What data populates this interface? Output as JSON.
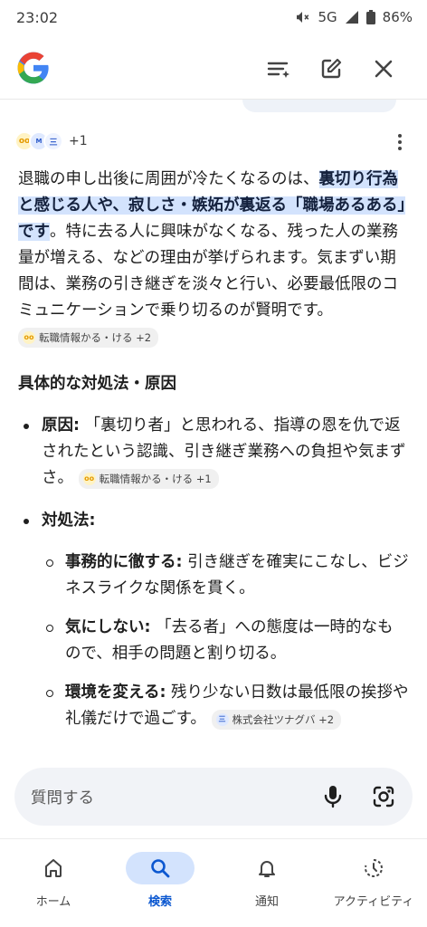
{
  "status_bar": {
    "time": "23:02",
    "network": "5G",
    "battery": "86%"
  },
  "header": {
    "logo_icon": "google-g-logo",
    "actions": [
      "filter-sparkle-icon",
      "edit-icon",
      "close-icon"
    ]
  },
  "sources": {
    "more": "+1"
  },
  "answer": {
    "highlight": "裏切り行為と感じる人や、寂しさ・嫉妬が裏返る「職場あるある」です",
    "lead": "退職の申し出後に周囲が冷たくなるのは、",
    "body": "。特に去る人に興味がなくなる、残った人の業務量が増える、などの理由が挙げられます。気まずい期間は、業務の引き継ぎを淡々と行い、必要最低限のコミュニケーションで乗り切るのが賢明です。",
    "chip": "転職情報かる・ける +2"
  },
  "section_heading": "具体的な対処法・原因",
  "bullets": [
    {
      "label": "原因:",
      "text": " 「裏切り者」と思われる、指導の恩を仇で返されたという認識、引き継ぎ業務への負担や気まずさ。",
      "chip": "転職情報かる・ける +1"
    },
    {
      "label": "対処法:"
    }
  ],
  "sub_bullets": [
    {
      "label": "事務的に徹する:",
      "text": " 引き継ぎを確実にこなし、ビジネスライクな関係を貫く。"
    },
    {
      "label": "気にしない:",
      "text": " 「去る者」への態度は一時的なもので、相手の問題と割り切る。"
    },
    {
      "label": "環境を変える:",
      "text": " 残り少ない日数は最低限の挨拶や礼儀だけで過ごす。",
      "chip": "株式会社ツナグバ +2"
    }
  ],
  "ask_bar": {
    "placeholder": "質問する"
  },
  "bottom_nav": [
    {
      "label": "ホーム",
      "icon": "home-icon"
    },
    {
      "label": "検索",
      "icon": "search-icon",
      "active": true
    },
    {
      "label": "通知",
      "icon": "bell-icon"
    },
    {
      "label": "アクティビティ",
      "icon": "activity-icon"
    }
  ],
  "colors": {
    "accent": "#0b57d0",
    "highlight": "#d3e3fd",
    "ask_bar": "#f1f3f7"
  }
}
